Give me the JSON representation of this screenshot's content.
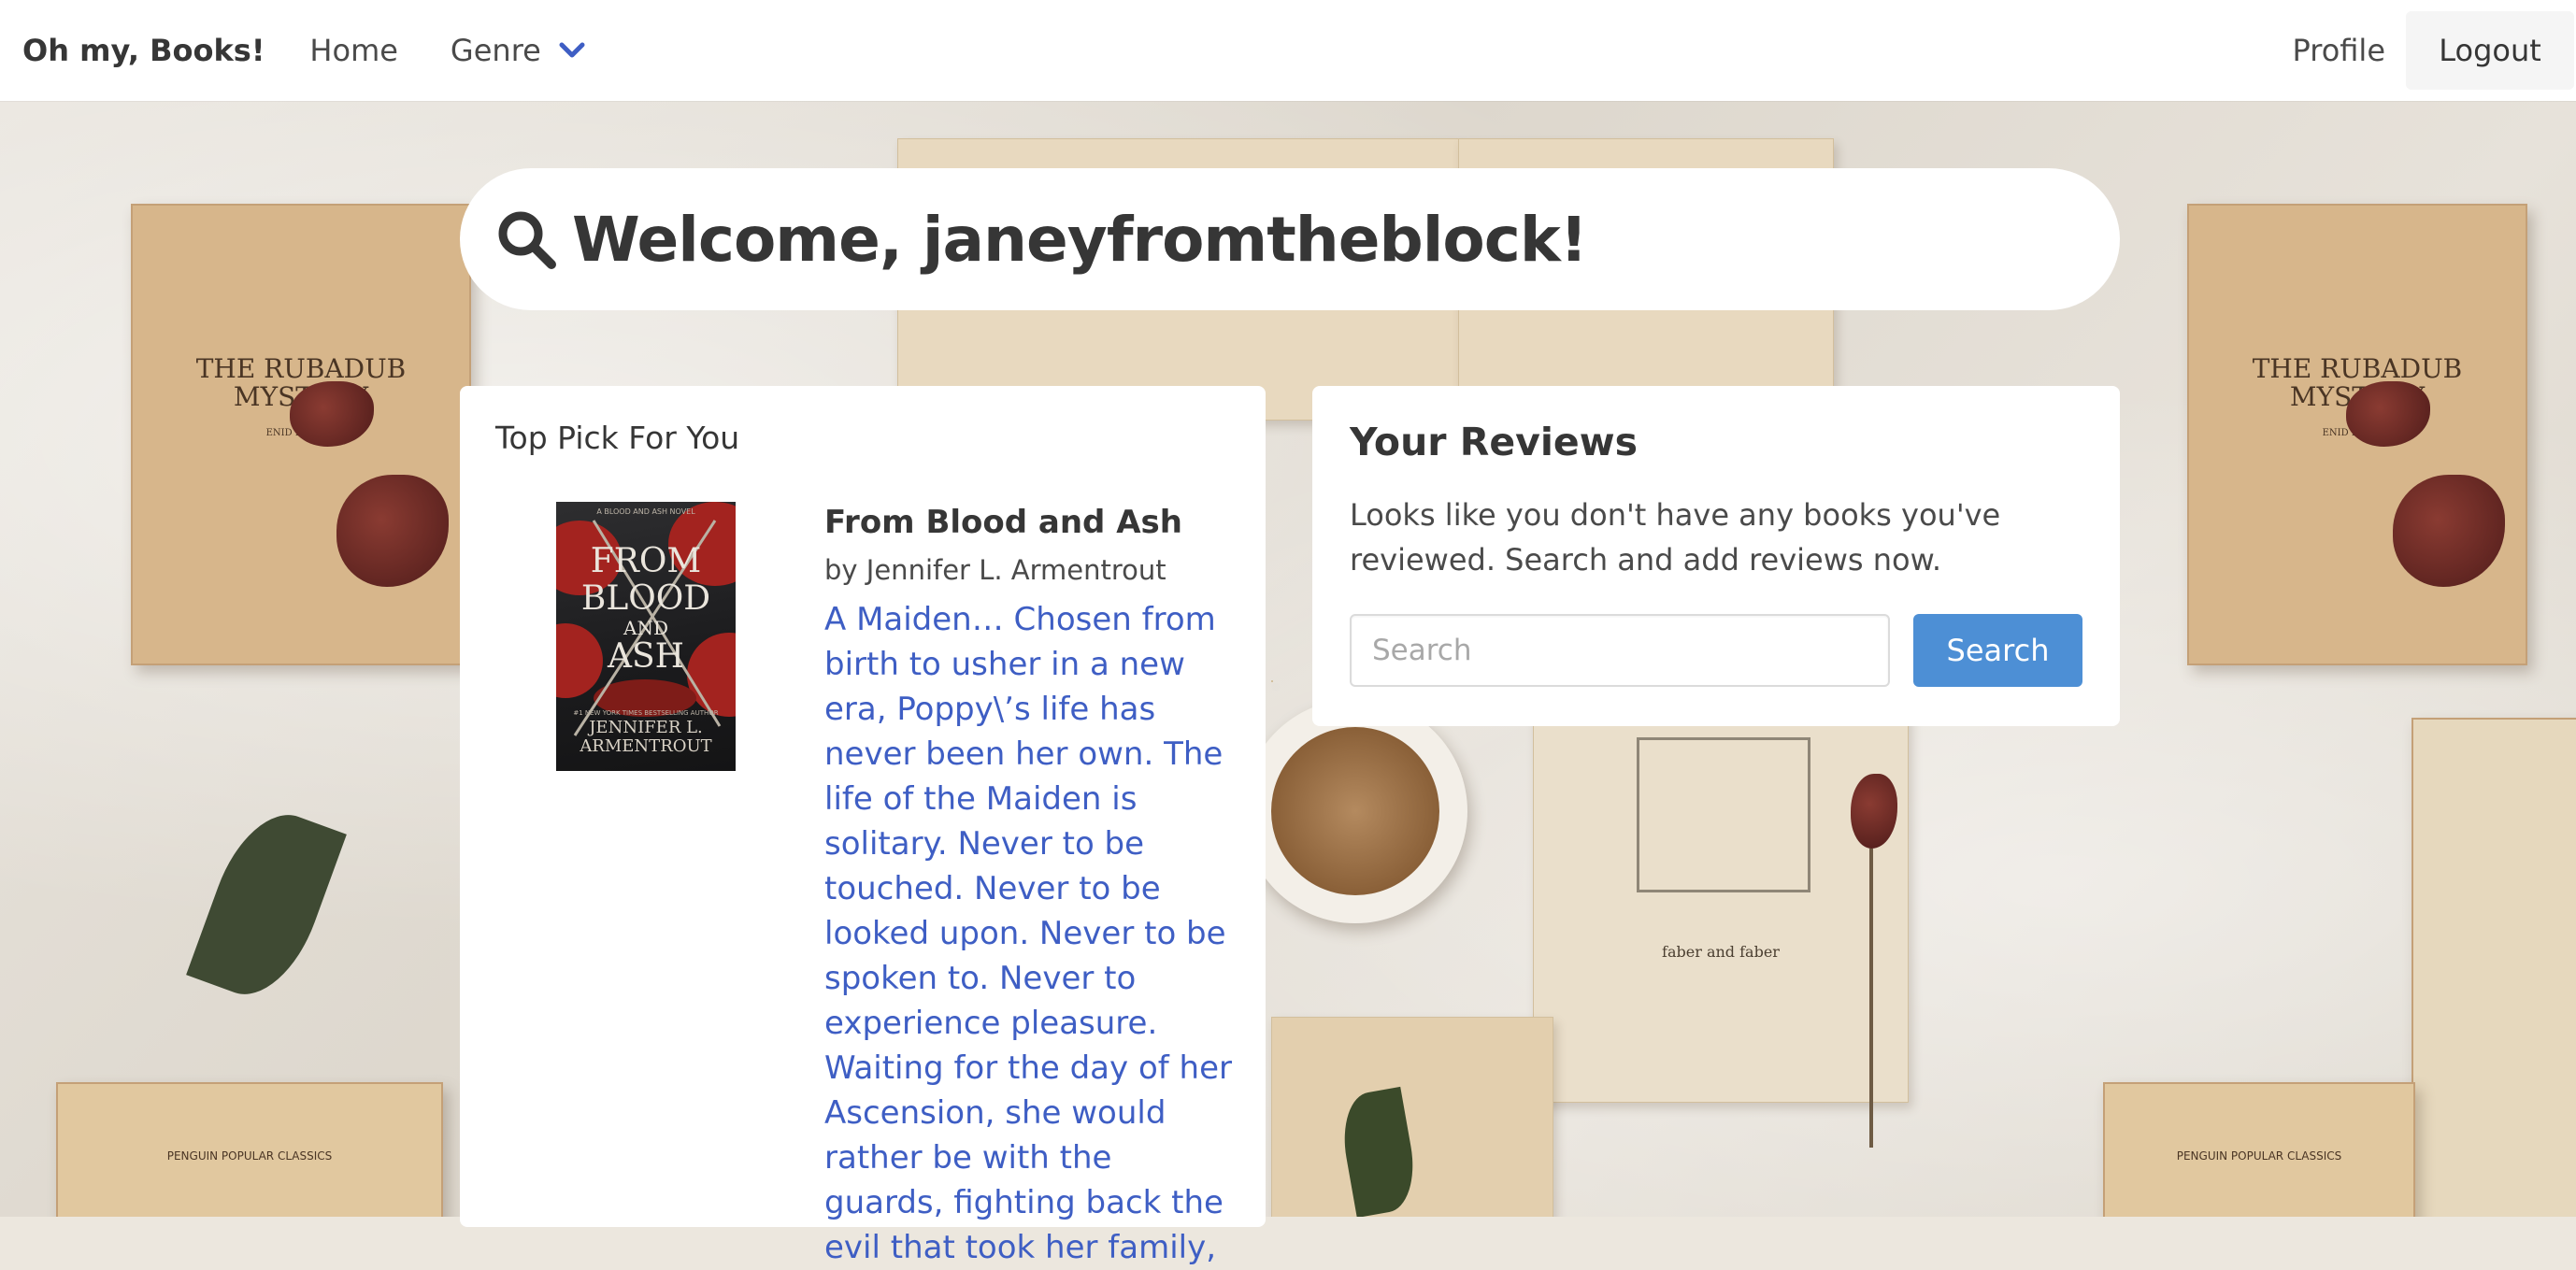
{
  "navbar": {
    "brand": "Oh my, Books!",
    "home": "Home",
    "genre": "Genre",
    "profile": "Profile",
    "logout": "Logout"
  },
  "welcome": {
    "text": "Welcome, janeyfromtheblock!"
  },
  "top_pick": {
    "heading": "Top Pick For You",
    "book": {
      "title": "From Blood and Ash",
      "author": "by Jennifer L. Armentrout",
      "description": "A Maiden… Chosen from birth to usher in a new era, Poppy\\’s life has never been her own. The life of the Maiden is solitary. Never to be touched. Never to be looked upon. Never to be spoken to. Never to experience pleasure. Waiting for the day of her Ascension, she would rather be with the guards, fighting back the evil that took her family,",
      "cover": {
        "top_line": "A BLOOD AND ASH NOVEL",
        "title_from": "FROM",
        "title_blood": "BLOOD",
        "title_and": "AND",
        "title_ash": "ASH",
        "tagline": "#1 NEW YORK TIMES BESTSELLING AUTHOR",
        "author_first": "JENNIFER L.",
        "author_last": "ARMENTROUT"
      }
    }
  },
  "reviews": {
    "heading": "Your Reviews",
    "empty_message": "Looks like you don't have any books you've reviewed. Search and add reviews now.",
    "search_placeholder": "Search",
    "search_button": "Search"
  },
  "background_books": {
    "left_title_1": "THE RUBADUB",
    "left_title_2": "MYSTERY",
    "left_author": "ENID BLYTON",
    "right_title_1": "THE RUBADUB",
    "right_title_2": "MYSTERY",
    "right_author": "ENID BLYTON",
    "penguin_left": "PENGUIN POPULAR CLASSICS",
    "penguin_right": "PENGUIN POPULAR CLASSICS",
    "faber": "faber and faber"
  },
  "colors": {
    "link_blue": "#3e5ec4",
    "button_blue": "#4d8fd5",
    "text_dark": "#363636"
  }
}
